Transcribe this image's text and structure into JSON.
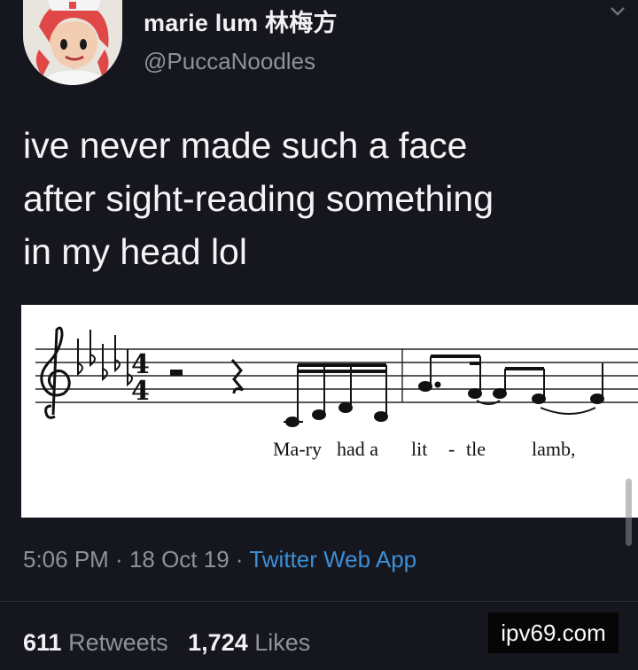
{
  "user": {
    "display_name": "marie lum 林梅方",
    "handle": "@PuccaNoodles",
    "avatar_icon": "avatar-illustration"
  },
  "tweet": {
    "text_line1": "ive never made such a face",
    "text_line2": "after sight-reading something",
    "text_line3": "in my head lol"
  },
  "sheet_music": {
    "lyrics": [
      "Ma-ry",
      "had a",
      "lit",
      "-",
      "tle",
      "lamb,"
    ]
  },
  "meta": {
    "time": "5:06 PM",
    "separator": " · ",
    "date": "18 Oct 19",
    "source": "Twitter Web App"
  },
  "stats": {
    "retweets_count": "611",
    "retweets_label": "Retweets",
    "likes_count": "1,724",
    "likes_label": "Likes"
  },
  "watermark": {
    "text": "ipv69.com"
  },
  "colors": {
    "background": "#16161f",
    "link": "#3b8fd6",
    "secondary_text": "#8e929a"
  }
}
